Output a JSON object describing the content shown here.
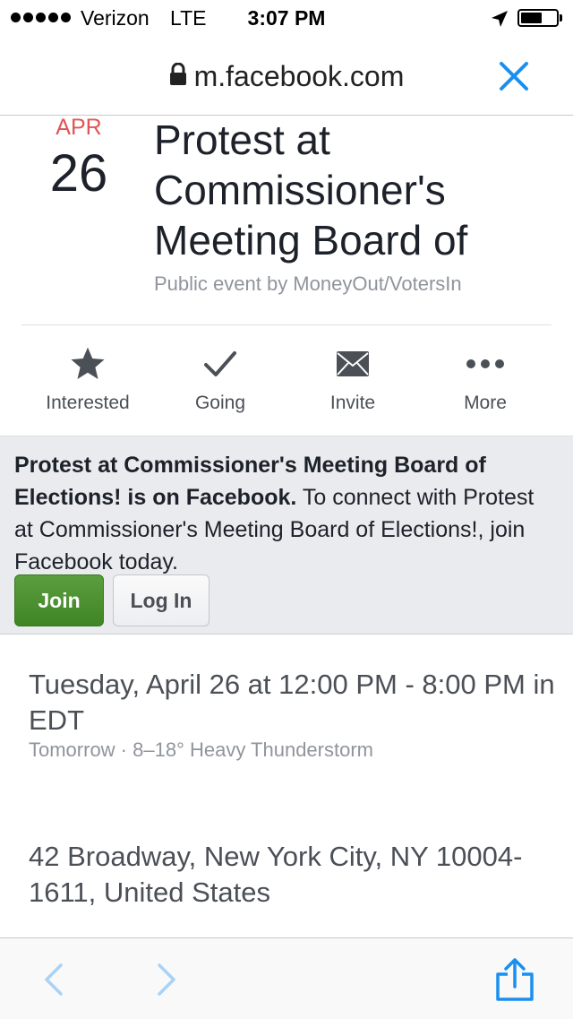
{
  "status_bar": {
    "carrier": "Verizon",
    "network": "LTE",
    "time": "3:07 PM",
    "battery_level": 0.6
  },
  "browser": {
    "url": "m.facebook.com"
  },
  "event": {
    "month": "APR",
    "day": "26",
    "title": "Protest at Commissioner's Meeting Board of",
    "host_line": "Public event by MoneyOut/VotersIn",
    "actions": [
      {
        "label": "Interested",
        "icon": "star-icon"
      },
      {
        "label": "Going",
        "icon": "checkmark-icon"
      },
      {
        "label": "Invite",
        "icon": "envelope-icon"
      },
      {
        "label": "More",
        "icon": "more-dots-icon"
      }
    ],
    "time_line": "Tuesday, April 26 at 12:00 PM - 8:00 PM in EDT",
    "weather_line": "Tomorrow · 8–18° Heavy Thunderstorm",
    "address": "42 Broadway, New York City, NY 10004-1611, United States"
  },
  "banner": {
    "bold_text": "Protest at Commissioner's Meeting Board of Elections! is on Facebook.",
    "body_text": " To connect with Protest at Commissioner's Meeting Board of Elections!, join Facebook today.",
    "join_label": "Join",
    "login_label": "Log In"
  },
  "colors": {
    "accent": "#1a8ff0",
    "month": "#e05555",
    "join": "#4a8f30"
  }
}
